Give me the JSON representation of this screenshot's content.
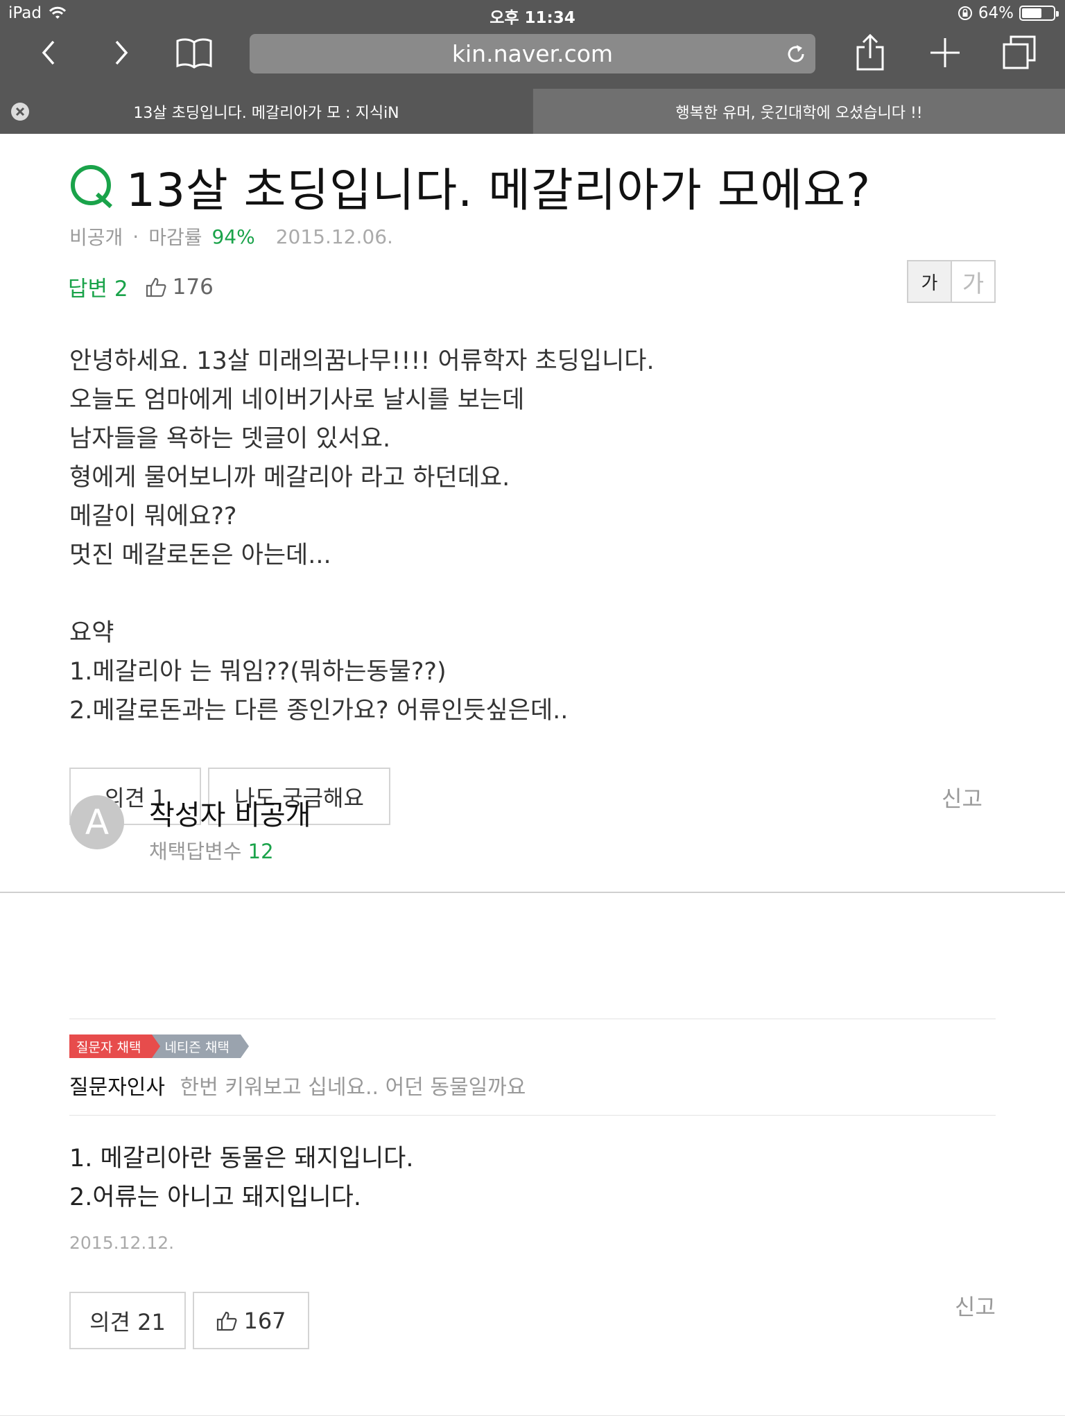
{
  "status_bar": {
    "device": "iPad",
    "time": "오후 11:34",
    "battery": "64%",
    "battery_level": 0.64
  },
  "browser": {
    "url": "kin.naver.com",
    "tabs": [
      {
        "label": "13살 초딩입니다. 메갈리아가 모 : 지식iN",
        "active": true
      },
      {
        "label": "행복한 유머, 웃긴대학에 오셨습니다 !!",
        "active": false
      }
    ]
  },
  "question": {
    "mark": "Q",
    "title": "13살 초딩입니다. 메갈리아가 모에요?",
    "author": "비공개",
    "close_rate_label": "마감률",
    "close_rate": "94%",
    "date": "2015.12.06.",
    "answers_label": "답변 2",
    "likes": "176",
    "font_small": "가",
    "font_large": "가",
    "body": [
      "안녕하세요. 13살 미래의꿈나무!!!! 어류학자 초딩입니다.",
      "오늘도 엄마에게 네이버기사로 날시를 보는데",
      "남자들을 욕하는 뎃글이 있서요.",
      "형에게 물어보니까 메갈리아 라고 하던데요.",
      "메갈이 뭐에요??",
      "멋진 메갈로돈은 아는데...",
      "",
      "요약",
      "1.메갈리아 는 뭐임??(뭐하는동물??)",
      "2.메갈로돈과는 다른 종인가요? 어류인듯싶은데.."
    ],
    "opinion_button": "의견 1",
    "curious_button": "나도 궁금해요",
    "report": "신고"
  },
  "answer": {
    "avatar_letter": "A",
    "author": "작성자 비공개",
    "adopted_label": "채택답변수",
    "adopted_count": "12",
    "badge_asker": "질문자 채택",
    "badge_netizen": "네티즌 채택",
    "greeting_label": "질문자인사",
    "greeting_text": "한번 키워보고 십네요.. 어던 동물일까요",
    "body": [
      "1. 메갈리아란 동물은 돼지입니다.",
      "2.어류는 아니고 돼지입니다."
    ],
    "date": "2015.12.12.",
    "opinion_button": "의견 21",
    "likes": "167",
    "report": "신고"
  },
  "colors": {
    "chrome": "#575757",
    "accent_green": "#1aa34a",
    "badge_red": "#e74c4c",
    "badge_gray": "#9aa3ae"
  }
}
